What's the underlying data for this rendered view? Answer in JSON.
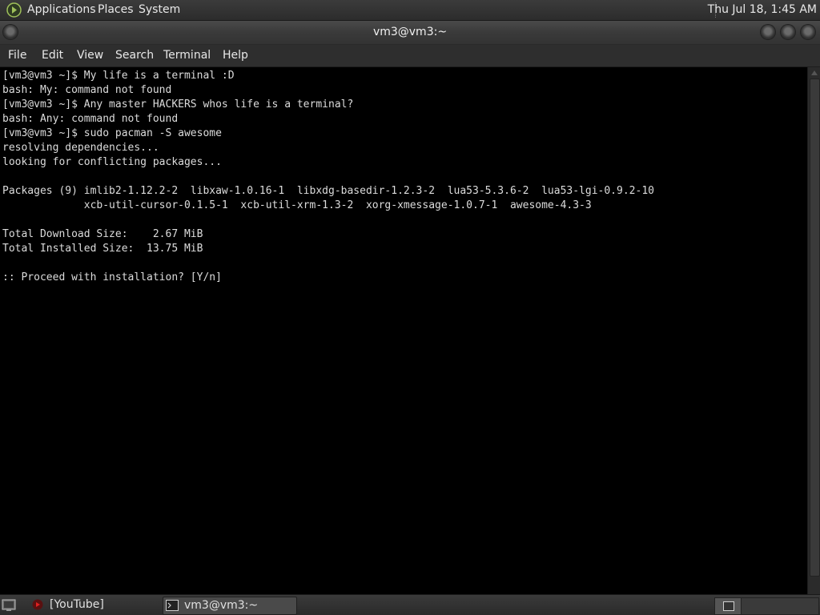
{
  "top_panel": {
    "menu": [
      "Applications",
      "Places",
      "System"
    ],
    "clock": "Thu Jul 18,  1:45 AM"
  },
  "window": {
    "title": "vm3@vm3:~"
  },
  "menubar": [
    "File",
    "Edit",
    "View",
    "Search",
    "Terminal",
    "Help"
  ],
  "terminal": {
    "lines": [
      "[vm3@vm3 ~]$ My life is a terminal :D",
      "bash: My: command not found",
      "[vm3@vm3 ~]$ Any master HACKERS whos life is a terminal?",
      "bash: Any: command not found",
      "[vm3@vm3 ~]$ sudo pacman -S awesome",
      "resolving dependencies...",
      "looking for conflicting packages...",
      "",
      "Packages (9) imlib2-1.12.2-2  libxaw-1.0.16-1  libxdg-basedir-1.2.3-2  lua53-5.3.6-2  lua53-lgi-0.9.2-10",
      "             xcb-util-cursor-0.1.5-1  xcb-util-xrm-1.3-2  xorg-xmessage-1.0.7-1  awesome-4.3-3",
      "",
      "Total Download Size:    2.67 MiB",
      "Total Installed Size:  13.75 MiB",
      "",
      ":: Proceed with installation? [Y/n]"
    ]
  },
  "taskbar": {
    "tasks": [
      {
        "label": "[YouTube]",
        "icon": "youtube-icon"
      },
      {
        "label": "vm3@vm3:~",
        "icon": "terminal-icon"
      }
    ]
  },
  "colors": {
    "terminal_bg": "#000000",
    "terminal_fg": "#dcdcdc",
    "panel_bg": "#333333",
    "youtube_red": "#e02020"
  }
}
